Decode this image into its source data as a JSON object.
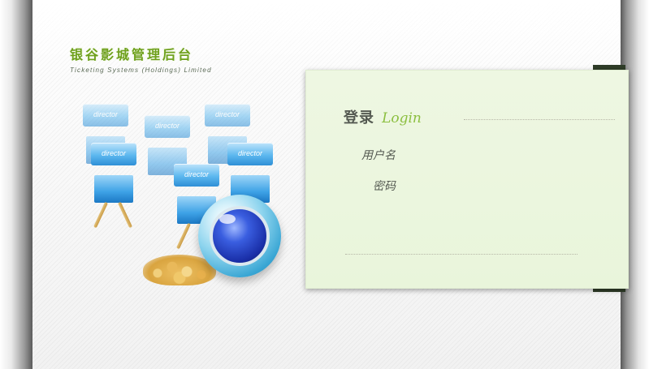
{
  "brand": {
    "title": "银谷影城管理后台",
    "subtitle": "Ticketing Systems (Holdings) Limited"
  },
  "illustration": {
    "chair_text": "director"
  },
  "login": {
    "title": "登录",
    "title_en": "Login",
    "username_label": "用户名",
    "username_value": "",
    "password_label": "密码",
    "password_value": ""
  },
  "colors": {
    "brand_green": "#6ea01c",
    "login_bg": "#eef7e2",
    "login_accent": "#8cbf40"
  }
}
